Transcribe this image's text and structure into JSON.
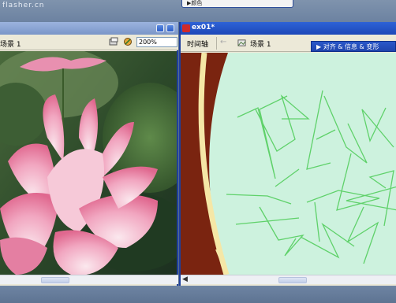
{
  "watermark": "flasher.cn",
  "top_menu": {
    "label": "▶颜色"
  },
  "left_window": {
    "scene_label": "场景 1",
    "zoom": "200%"
  },
  "right_window": {
    "title": "ex01*",
    "timeline_label": "时间轴",
    "back_arrow": "←",
    "scene_label": "场景 1",
    "scroll_arrow": "◀"
  },
  "panel": {
    "label": "▶ 对齐 & 信息 & 变形"
  },
  "colors": {
    "stage_bg": "#cdf2de",
    "arc_brown": "#7a2410",
    "arc_cream": "#f5e7a6",
    "scribble": "#5fd16a",
    "title_active": "#2e62d6"
  }
}
